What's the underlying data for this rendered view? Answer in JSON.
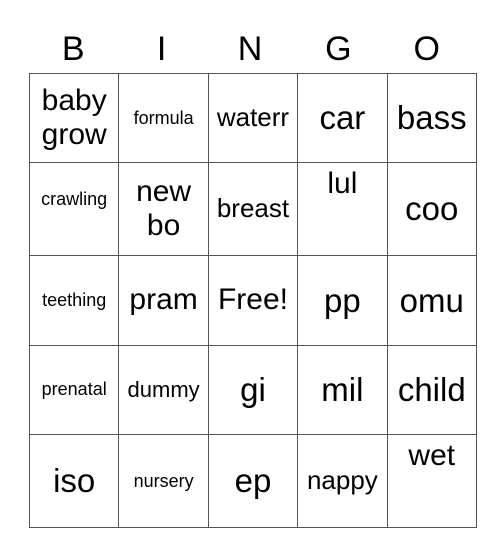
{
  "header": {
    "letters": [
      "B",
      "I",
      "N",
      "G",
      "O"
    ]
  },
  "grid": {
    "rows": [
      [
        "baby grow",
        "formula",
        "waterr",
        "car",
        "bass"
      ],
      [
        "crawling",
        "new bo",
        "breast",
        "lul",
        "coo"
      ],
      [
        "teething",
        "pram",
        "Free!",
        "pp",
        "omu"
      ],
      [
        "prenatal",
        "dummy",
        "gi",
        "mil",
        "child"
      ],
      [
        "iso",
        "nursery",
        "ep",
        "nappy",
        "wet"
      ]
    ]
  }
}
